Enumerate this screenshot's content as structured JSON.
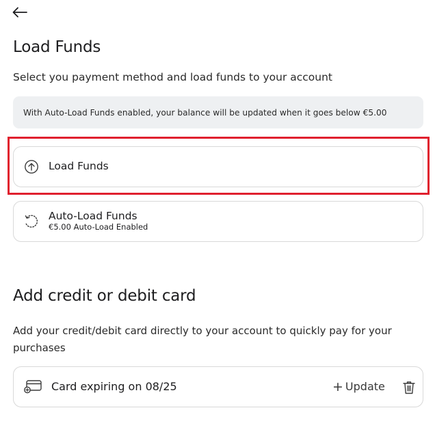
{
  "header": {
    "back_icon": "arrow-left-icon",
    "title": "Load Funds",
    "subtitle": "Select you payment method and load funds to your account"
  },
  "info": {
    "text": "With Auto-Load Funds enabled, your balance will be updated when it goes below €5.00"
  },
  "options": [
    {
      "icon": "arrow-up-circle-icon",
      "label": "Load Funds"
    },
    {
      "icon": "refresh-icon",
      "label": "Auto-Load Funds",
      "sublabel": "€5.00 Auto-Load Enabled"
    }
  ],
  "card_section": {
    "title": "Add credit or debit card",
    "description": "Add your credit/debit card directly to your account to quickly pay for your purchases",
    "card": {
      "icon": "credit-card-icon",
      "label": "Card expiring on 08/25",
      "update_plus": "+",
      "update_label": "Update",
      "delete_icon": "trash-icon"
    }
  },
  "colors": {
    "highlight": "#e0202e",
    "info_bg": "#eef0f2",
    "border": "#d8d8d8",
    "text": "#1d1d1f"
  }
}
